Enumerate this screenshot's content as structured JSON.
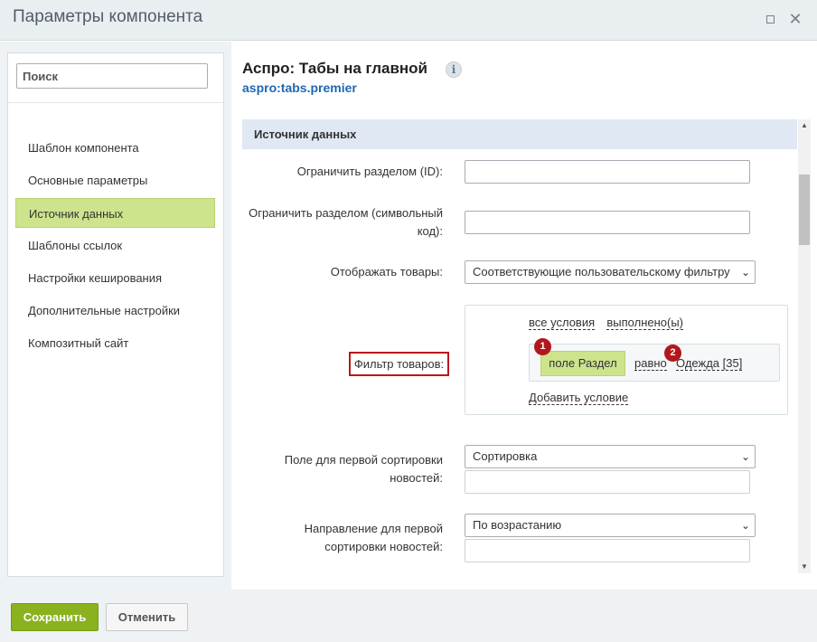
{
  "window": {
    "title": "Параметры компонента"
  },
  "sidebar": {
    "search_placeholder": "Поиск",
    "items": [
      {
        "label": "Шаблон компонента",
        "active": false
      },
      {
        "label": "Основные параметры",
        "active": false
      },
      {
        "label": "Источник данных",
        "active": true
      },
      {
        "label": "Шаблоны ссылок",
        "active": false
      },
      {
        "label": "Настройки кеширования",
        "active": false
      },
      {
        "label": "Дополнительные настройки",
        "active": false
      },
      {
        "label": "Композитный сайт",
        "active": false
      }
    ]
  },
  "component": {
    "title": "Аспро: Табы на главной",
    "code": "aspro:tabs.premier",
    "info_icon": "i"
  },
  "section": {
    "title": "Источник данных"
  },
  "fields": {
    "section_id_label": "Ограничить разделом (ID):",
    "section_id_value": "",
    "section_code_label_1": "Ограничить разделом (символьный",
    "section_code_label_2": "код):",
    "section_code_value": "",
    "display_goods_label": "Отображать товары:",
    "display_goods_value": "Соответствующие пользовательскому фильтру",
    "filter_label": "Фильтр товаров:",
    "sort1_label_1": "Поле для первой сортировки",
    "sort1_label_2": "новостей:",
    "sort1_value": "Сортировка",
    "dir1_label_1": "Направление для первой",
    "dir1_label_2": "сортировки новостей:",
    "dir1_value": "По возрастанию"
  },
  "filter": {
    "all_conditions": "все условия",
    "fulfilled": "выполнено(ы)",
    "field_chip": "поле Раздел",
    "operator": "равно",
    "value": "Одежда [35]",
    "add_condition": "Добавить условие",
    "badge_1": "1",
    "badge_2": "2"
  },
  "footer": {
    "save_label": "Сохранить",
    "cancel_label": "Отменить"
  },
  "colors": {
    "accent_green": "#8ab21f",
    "active_nav": "#cde38c",
    "link_blue": "#2067b0",
    "badge_red": "#b3171e"
  }
}
